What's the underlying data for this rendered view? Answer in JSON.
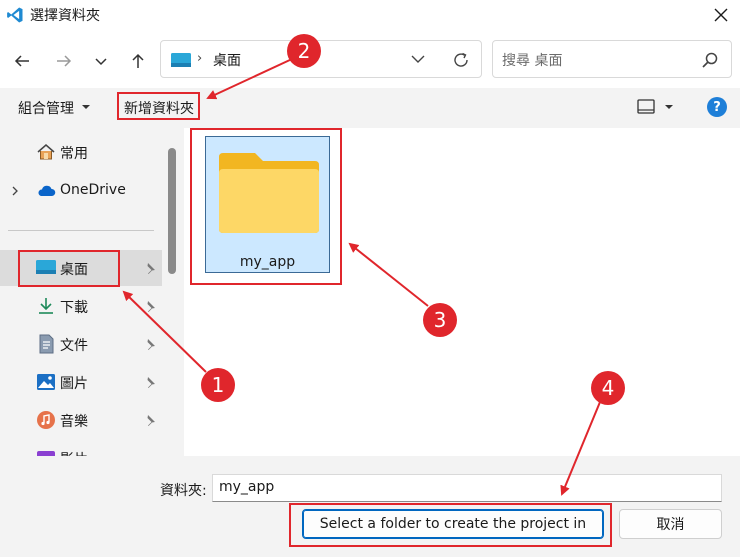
{
  "window": {
    "title": "選擇資料夾"
  },
  "navigation": {
    "location": "桌面",
    "search_placeholder": "搜尋 桌面"
  },
  "toolbar": {
    "organize_label": "組合管理",
    "new_folder_label": "新增資料夾",
    "help_label": "?"
  },
  "sidebar": {
    "items": [
      {
        "label": "常用",
        "icon": "home-icon"
      },
      {
        "label": "OneDrive",
        "icon": "cloud-icon"
      },
      {
        "label": "桌面",
        "icon": "desktop-icon"
      },
      {
        "label": "下載",
        "icon": "download-icon"
      },
      {
        "label": "文件",
        "icon": "document-icon"
      },
      {
        "label": "圖片",
        "icon": "picture-icon"
      },
      {
        "label": "音樂",
        "icon": "music-icon"
      },
      {
        "label": "影片",
        "icon": "video-icon"
      }
    ]
  },
  "content": {
    "files": [
      {
        "name": "my_app",
        "type": "folder"
      }
    ]
  },
  "footer": {
    "folder_label": "資料夾:",
    "folder_value": "my_app",
    "select_button": "Select a folder to create the project in",
    "cancel_button": "取消"
  },
  "annotations": {
    "color": "#e0262c",
    "steps": [
      "1",
      "2",
      "3",
      "4"
    ]
  }
}
